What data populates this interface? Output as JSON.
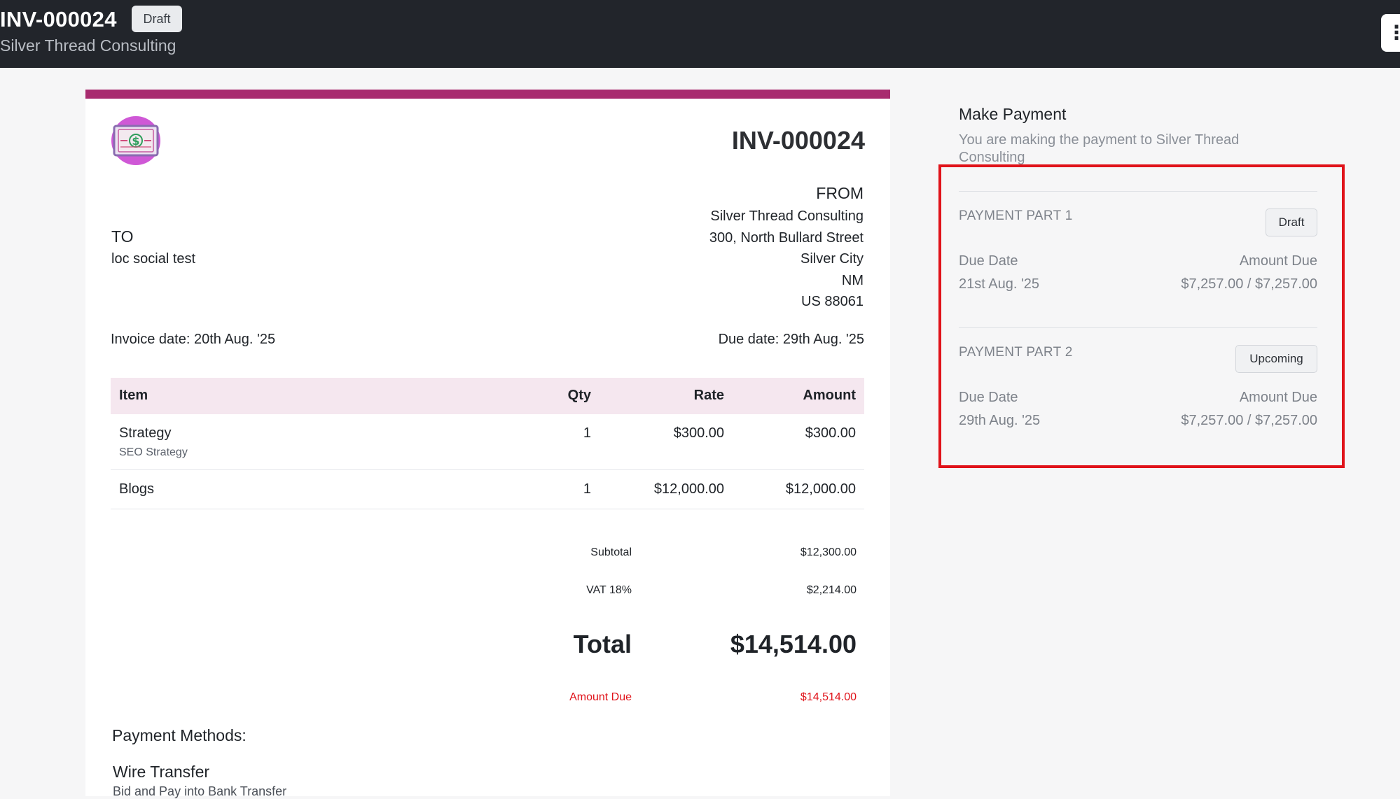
{
  "header": {
    "invoice_id": "INV-000024",
    "status": "Draft",
    "company": "Silver Thread Consulting",
    "menu_icon": "kebab-menu-icon"
  },
  "invoice": {
    "accent_color": "#a82b6f",
    "logo_icon": "dollar-bill-icon",
    "number": "INV-000024",
    "from": {
      "label": "FROM",
      "name": "Silver Thread Consulting",
      "street": "300, North Bullard Street",
      "city": "Silver City",
      "state": "NM",
      "zip": "US 88061"
    },
    "to": {
      "label": "TO",
      "name": "loc social test"
    },
    "invoice_date": "Invoice date: 20th Aug. '25",
    "due_date": "Due date: 29th Aug. '25",
    "table": {
      "headers": {
        "item": "Item",
        "qty": "Qty",
        "rate": "Rate",
        "amount": "Amount"
      },
      "rows": [
        {
          "item": "Strategy",
          "desc": "SEO Strategy",
          "qty": "1",
          "rate": "$300.00",
          "amount": "$300.00"
        },
        {
          "item": "Blogs",
          "desc": "",
          "qty": "1",
          "rate": "$12,000.00",
          "amount": "$12,000.00"
        }
      ]
    },
    "totals": {
      "subtotal_label": "Subtotal",
      "subtotal": "$12,300.00",
      "vat_label": "VAT 18%",
      "vat": "$2,214.00",
      "total_label": "Total",
      "total": "$14,514.00",
      "amount_due_label": "Amount Due",
      "amount_due": "$14,514.00",
      "amount_due_color": "#e0131a"
    },
    "payment_methods_label": "Payment Methods:",
    "wire_transfer": "Wire Transfer",
    "wire_sub": "Bid and Pay into Bank Transfer"
  },
  "payment": {
    "title": "Make Payment",
    "subtitle": "You are making the payment to Silver Thread Consulting",
    "parts": [
      {
        "label": "PAYMENT PART 1",
        "status": "Draft",
        "due_date_label": "Due Date",
        "due_date": "21st Aug. '25",
        "amount_label": "Amount Due",
        "amount": "$7,257.00 / $7,257.00"
      },
      {
        "label": "PAYMENT PART 2",
        "status": "Upcoming",
        "due_date_label": "Due Date",
        "due_date": "29th Aug. '25",
        "amount_label": "Amount Due",
        "amount": "$7,257.00 / $7,257.00"
      }
    ],
    "highlight_color": "#e0131a"
  }
}
